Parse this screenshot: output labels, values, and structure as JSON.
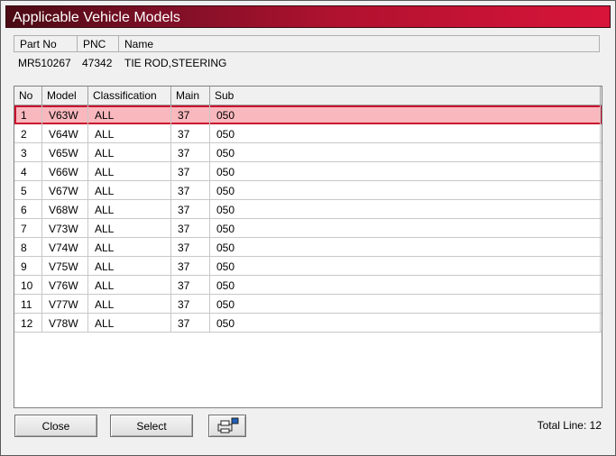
{
  "window": {
    "title": "Applicable Vehicle Models"
  },
  "info": {
    "headers": {
      "part_no": "Part No",
      "pnc": "PNC",
      "name": "Name"
    },
    "values": {
      "part_no": "MR510267",
      "pnc": "47342",
      "name": "TIE ROD,STEERING"
    }
  },
  "grid": {
    "headers": {
      "no": "No",
      "model": "Model",
      "classification": "Classification",
      "main": "Main",
      "sub": "Sub"
    },
    "rows": [
      {
        "no": "1",
        "model": "V63W",
        "classification": "ALL",
        "main": "37",
        "sub": "050",
        "selected": true
      },
      {
        "no": "2",
        "model": "V64W",
        "classification": "ALL",
        "main": "37",
        "sub": "050"
      },
      {
        "no": "3",
        "model": "V65W",
        "classification": "ALL",
        "main": "37",
        "sub": "050"
      },
      {
        "no": "4",
        "model": "V66W",
        "classification": "ALL",
        "main": "37",
        "sub": "050"
      },
      {
        "no": "5",
        "model": "V67W",
        "classification": "ALL",
        "main": "37",
        "sub": "050"
      },
      {
        "no": "6",
        "model": "V68W",
        "classification": "ALL",
        "main": "37",
        "sub": "050"
      },
      {
        "no": "7",
        "model": "V73W",
        "classification": "ALL",
        "main": "37",
        "sub": "050"
      },
      {
        "no": "8",
        "model": "V74W",
        "classification": "ALL",
        "main": "37",
        "sub": "050"
      },
      {
        "no": "9",
        "model": "V75W",
        "classification": "ALL",
        "main": "37",
        "sub": "050"
      },
      {
        "no": "10",
        "model": "V76W",
        "classification": "ALL",
        "main": "37",
        "sub": "050"
      },
      {
        "no": "11",
        "model": "V77W",
        "classification": "ALL",
        "main": "37",
        "sub": "050"
      },
      {
        "no": "12",
        "model": "V78W",
        "classification": "ALL",
        "main": "37",
        "sub": "050"
      }
    ]
  },
  "buttons": {
    "close": "Close",
    "select": "Select",
    "print_icon": "print-preview-icon"
  },
  "status": {
    "total_line": "Total Line: 12"
  },
  "colors": {
    "title_accent": "#d8143a",
    "selection_fill": "#f9b8bd",
    "selection_border": "#c8102e"
  }
}
